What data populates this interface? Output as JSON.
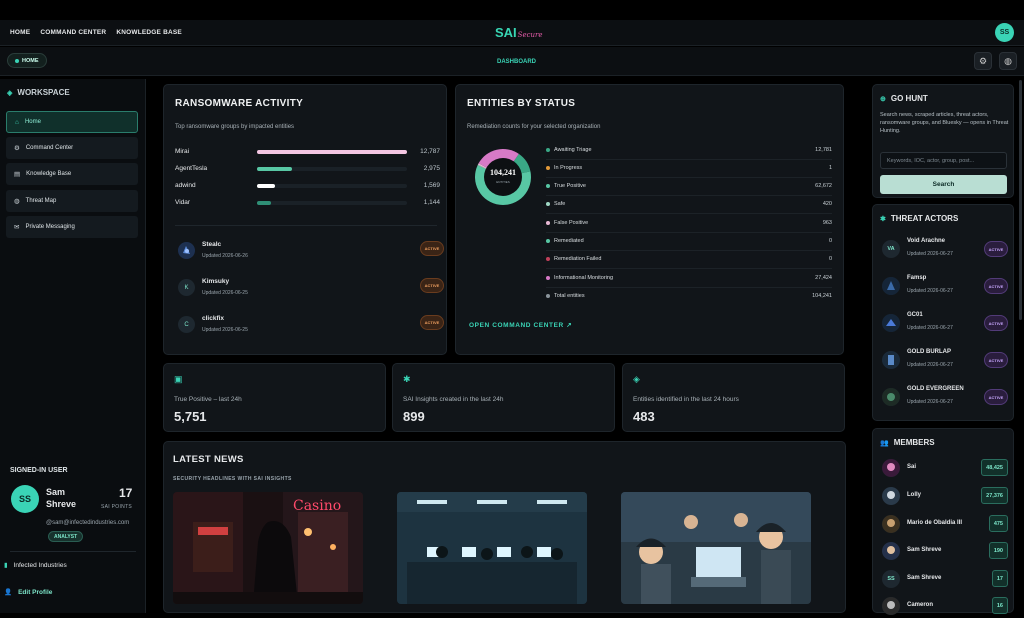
{
  "nav": {
    "home": "HOME",
    "command_center": "COMMAND CENTER",
    "knowledge_base": "KNOWLEDGE BASE"
  },
  "logo": {
    "main": "SAI",
    "script": "Secure"
  },
  "top_avatar": "SS",
  "breadcrumb": "HOME",
  "page_title": "DASHBOARD",
  "icons": {
    "settings": "gear-icon",
    "globe": "globe-icon"
  },
  "sidebar": {
    "heading": "WORKSPACE",
    "items": [
      {
        "label": "Home",
        "icon": "home-icon"
      },
      {
        "label": "Command Center",
        "icon": "gear-icon"
      },
      {
        "label": "Knowledge Base",
        "icon": "book-icon"
      },
      {
        "label": "Threat Map",
        "icon": "globe-icon"
      },
      {
        "label": "Private Messaging",
        "icon": "chat-icon"
      }
    ]
  },
  "user": {
    "heading": "SIGNED-IN USER",
    "initials": "SS",
    "name": "Sam Shreve",
    "points": "17",
    "points_label": "SAI POINTS",
    "email": "@sam@infectedindustries.com",
    "role": "ANALYST",
    "org": "Infected Industries",
    "edit": "Edit Profile"
  },
  "ransomware": {
    "title": "RANSOMWARE ACTIVITY",
    "subtitle": "Top ransomware groups by impacted entities",
    "bars": [
      {
        "name": "Mirai",
        "value": "12,787",
        "fraction": 1.0,
        "color": "#f4c6e2"
      },
      {
        "name": "AgentTesla",
        "value": "2,975",
        "fraction": 0.23,
        "color": "#58c7a4"
      },
      {
        "name": "adwind",
        "value": "1,569",
        "fraction": 0.12,
        "color": "#ffffff"
      },
      {
        "name": "Vidar",
        "value": "1,144",
        "fraction": 0.09,
        "color": "#2f8f76"
      }
    ],
    "groups": [
      {
        "name": "Stealc",
        "updated": "Updated 2026-06-26",
        "badge": "ACTIVE",
        "initial": ""
      },
      {
        "name": "Kimsuky",
        "updated": "Updated 2026-06-25",
        "badge": "ACTIVE",
        "initial": "K"
      },
      {
        "name": "clickfix",
        "updated": "Updated 2026-06-25",
        "badge": "ACTIVE",
        "initial": "C"
      }
    ]
  },
  "entities": {
    "title": "ENTITIES BY STATUS",
    "subtitle": "Remediation counts for your selected organization",
    "total": "104,241",
    "total_label": "ENTITIES",
    "rows": [
      {
        "label": "Awaiting Triage",
        "value": "12,781",
        "color": "#3aa886"
      },
      {
        "label": "In Progress",
        "value": "1",
        "color": "#e39a3a"
      },
      {
        "label": "True Positive",
        "value": "62,672",
        "color": "#58c7a4"
      },
      {
        "label": "Safe",
        "value": "420",
        "color": "#9fd8c4"
      },
      {
        "label": "False Positive",
        "value": "963",
        "color": "#e7b8d4"
      },
      {
        "label": "Remediated",
        "value": "0",
        "color": "#58c7a4"
      },
      {
        "label": "Remediation Failed",
        "value": "0",
        "color": "#c0405a"
      },
      {
        "label": "Informational Monitoring",
        "value": "27,424",
        "color": "#d77ac7"
      },
      {
        "label": "Total entities",
        "value": "104,241",
        "color": "#8a949b"
      }
    ],
    "link": "OPEN COMMAND CENTER"
  },
  "stats": [
    {
      "label": "True Positive – last 24h",
      "value": "5,751",
      "icon": "monitor-icon"
    },
    {
      "label": "SAI Insights created in the last 24h",
      "value": "899",
      "icon": "bug-icon"
    },
    {
      "label": "Entities identified in the last 24 hours",
      "value": "483",
      "icon": "layers-icon"
    }
  ],
  "news": {
    "title": "LATEST NEWS",
    "subtitle": "SECURITY HEADLINES WITH SAI INSIGHTS",
    "casino_sign": "Casino"
  },
  "go_hunt": {
    "title": "GO HUNT",
    "text": "Search news, scraped articles, threat actors, ransomware groups, and Bluesky — opens in Threat Hunting.",
    "placeholder": "Keywords, IOC, actor, group, post...",
    "button": "Search"
  },
  "threat_actors": {
    "title": "THREAT ACTORS",
    "items": [
      {
        "initials": "VA",
        "name": "Void Arachne",
        "updated": "Updated 2026-06-27",
        "badge": "ACTIVE"
      },
      {
        "initials": "",
        "name": "Famsp",
        "updated": "Updated 2026-06-27",
        "badge": "ACTIVE"
      },
      {
        "initials": "",
        "name": "GC01",
        "updated": "Updated 2026-06-27",
        "badge": "ACTIVE"
      },
      {
        "initials": "",
        "name": "GOLD BURLAP",
        "updated": "Updated 2026-06-27",
        "badge": "ACTIVE"
      },
      {
        "initials": "",
        "name": "GOLD EVERGREEN",
        "updated": "Updated 2026-06-27",
        "badge": "ACTIVE"
      }
    ]
  },
  "members": {
    "title": "MEMBERS",
    "items": [
      {
        "initials": "",
        "name": "Sai",
        "points": "48,425"
      },
      {
        "initials": "",
        "name": "Lolly",
        "points": "27,376"
      },
      {
        "initials": "",
        "name": "Mario de Obaldia III",
        "points": "475"
      },
      {
        "initials": "",
        "name": "Sam Shreve",
        "points": "190"
      },
      {
        "initials": "SS",
        "name": "Sam Shreve",
        "points": "17"
      },
      {
        "initials": "",
        "name": "Cameron",
        "points": "16"
      }
    ]
  }
}
